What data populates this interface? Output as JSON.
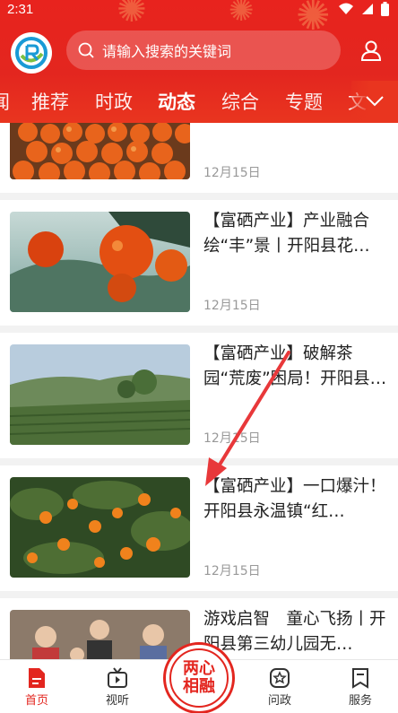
{
  "status_bar": {
    "time": "2:31"
  },
  "search": {
    "placeholder": "请输入搜索的关键词"
  },
  "tabs": [
    {
      "label": "闻"
    },
    {
      "label": "推荐"
    },
    {
      "label": "时政"
    },
    {
      "label": "动态",
      "active": true
    },
    {
      "label": "综合"
    },
    {
      "label": "专题"
    },
    {
      "label": "文"
    }
  ],
  "feed": [
    {
      "title": "",
      "date": "12月15日"
    },
    {
      "title": "【富硒产业】产业融合绘“丰”景丨开阳县花…",
      "date": "12月15日"
    },
    {
      "title": "【富硒产业】破解茶园“荒废”困局！开阳县…",
      "date": "12月15日"
    },
    {
      "title": "【富硒产业】一口爆汁！开阳县永温镇“红…",
      "date": "12月15日"
    },
    {
      "title": "游戏启智　童心飞扬丨开阳县第三幼儿园无…",
      "date": ""
    }
  ],
  "bottom_nav": {
    "home": "首页",
    "video": "视听",
    "center": "两心相融",
    "inquiry": "问政",
    "service": "服务"
  },
  "colors": {
    "brand_red": "#e3261f",
    "header_red": "#e8231e"
  }
}
